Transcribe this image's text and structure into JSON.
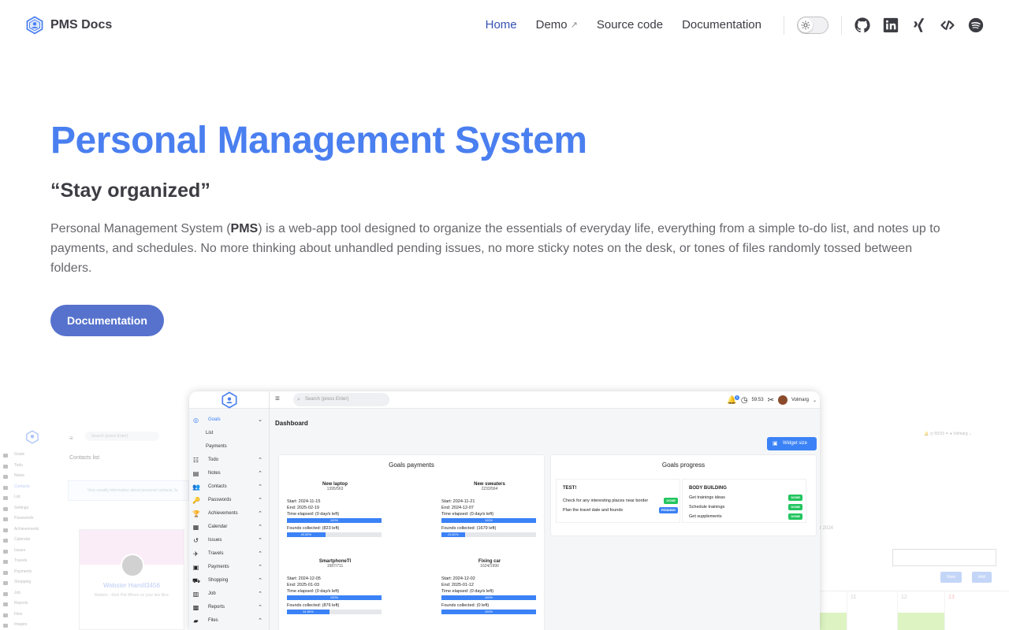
{
  "nav": {
    "brand": "PMS Docs",
    "links": [
      {
        "label": "Home",
        "active": true
      },
      {
        "label": "Demo",
        "external": true
      },
      {
        "label": "Source code"
      },
      {
        "label": "Documentation"
      }
    ],
    "external_arrow": "↗",
    "social": [
      "github-icon",
      "linkedin-icon",
      "xing-icon",
      "codepen-icon",
      "spotify-icon"
    ]
  },
  "hero": {
    "title": "Personal Management System",
    "tagline": "“Stay organized”",
    "text_before": "Personal Management System (",
    "text_bold": "PMS",
    "text_after": ") is a web-app tool designed to organize the essentials of everyday life, everything from a simple to-do list, and notes up to payments, and schedules. No more thinking about unhandled pending issues, no more sticky notes on the desk, or tones of files randomly tossed between folders.",
    "button": "Documentation"
  },
  "colors": {
    "title": "#4a7ff0",
    "active_link": "#3451b2",
    "button": "#5672cd",
    "app_accent": "#3b82f6",
    "done": "#22c55e"
  },
  "app": {
    "search_placeholder": "Search (press Enter)",
    "notification_count": "5",
    "time": "59:53",
    "user": "Volmarg",
    "page_title": "Dashboard",
    "widget_button": "Widget size",
    "sidebar": [
      {
        "label": "Goals",
        "icon": "goals-icon",
        "active": true,
        "chev": "⌄"
      },
      {
        "label": "List",
        "sub": true
      },
      {
        "label": "Payments",
        "sub": true
      },
      {
        "label": "Todo",
        "icon": "todo-icon",
        "chev": "⌃"
      },
      {
        "label": "Notes",
        "icon": "notes-icon",
        "chev": "⌃"
      },
      {
        "label": "Contacts",
        "icon": "contacts-icon",
        "chev": "⌃"
      },
      {
        "label": "Passwords",
        "icon": "passwords-icon",
        "chev": "⌃"
      },
      {
        "label": "Achievements",
        "icon": "achievements-icon",
        "chev": "⌃"
      },
      {
        "label": "Calendar",
        "icon": "calendar-icon",
        "chev": "⌃"
      },
      {
        "label": "Issues",
        "icon": "issues-icon",
        "chev": "⌃"
      },
      {
        "label": "Travels",
        "icon": "travels-icon",
        "chev": "⌃"
      },
      {
        "label": "Payments",
        "icon": "payments-icon",
        "chev": "⌃"
      },
      {
        "label": "Shopping",
        "icon": "shopping-icon",
        "chev": "⌃"
      },
      {
        "label": "Job",
        "icon": "job-icon",
        "chev": "⌃"
      },
      {
        "label": "Reports",
        "icon": "reports-icon",
        "chev": "⌃"
      },
      {
        "label": "Files",
        "icon": "files-icon",
        "chev": "⌃"
      }
    ],
    "goals_payments": {
      "title": "Goals payments",
      "items": [
        {
          "name": "New laptop",
          "amount": "1395/563",
          "start": "Start: 2024-11-15",
          "end": "End: 2025-02-19",
          "time_label": "Time elapsed: (0 day/s left)",
          "time_pct": 100,
          "time_text": "100%",
          "funds_label": "Founds collected: (823 left)",
          "funds_pct": 40.52,
          "funds_text": "40.52%"
        },
        {
          "name": "New sweaters",
          "amount": "2233/564",
          "start": "Start: 2024-11-21",
          "end": "End: 2024-12-07",
          "time_label": "Time elapsed: (0 day/s left)",
          "time_pct": 100,
          "time_text": "100%",
          "funds_label": "Founds collected: (1679 left)",
          "funds_pct": 24.81,
          "funds_text": "24.81%"
        },
        {
          "name": "SmartphoneTI",
          "amount": "1587/711",
          "start": "Start: 2024-12-05",
          "end": "End: 2025-01-03",
          "time_label": "Time elapsed: (0 day/s left)",
          "time_pct": 100,
          "time_text": "100%",
          "funds_label": "Founds collected: (876 left)",
          "funds_pct": 44.8,
          "funds_text": "44.80%"
        },
        {
          "name": "Fixing car",
          "amount": "1624/1990",
          "start": "Start: 2024-12-02",
          "end": "End: 2025-01-12",
          "time_label": "Time elapsed: (0 day/s left)",
          "time_pct": 100,
          "time_text": "100%",
          "funds_label": "Founds collected: (0 left)",
          "funds_pct": 100,
          "funds_text": "100%"
        }
      ]
    },
    "goals_progress": {
      "title": "Goals progress",
      "lists": [
        {
          "name": "TEST!",
          "rows": [
            {
              "text": "Check for any interesting places near border",
              "status": "DONE"
            },
            {
              "text": "Plan the travel date and founds",
              "status": "PENDING"
            }
          ]
        },
        {
          "name": "BODY BUILDING",
          "rows": [
            {
              "text": "Get trainings ideas",
              "status": "DONE"
            },
            {
              "text": "Schedule trainings",
              "status": "DONE"
            },
            {
              "text": "Get supplements",
              "status": "DONE"
            }
          ]
        }
      ]
    }
  },
  "bg_left": {
    "page_title": "Contacts list",
    "info_text": "Very usually information about personal contacts, fu",
    "contact_name": "Webster Hamill3456",
    "contact_sub": "Malisho - Rish Pat Where ox your ties Bisc",
    "sidebar": [
      "Goals",
      "Todo",
      "Notes",
      "Contacts",
      "List",
      "Settings",
      "Passwords",
      "Achievements",
      "Calendar",
      "Issues",
      "Travels",
      "Payments",
      "Shopping",
      "Job",
      "Reports",
      "Files",
      "Images"
    ]
  },
  "bg_right": {
    "year_text": "r 2024",
    "view_button": "View",
    "add_button": "Add",
    "days": [
      "11",
      "12",
      "13"
    ]
  }
}
